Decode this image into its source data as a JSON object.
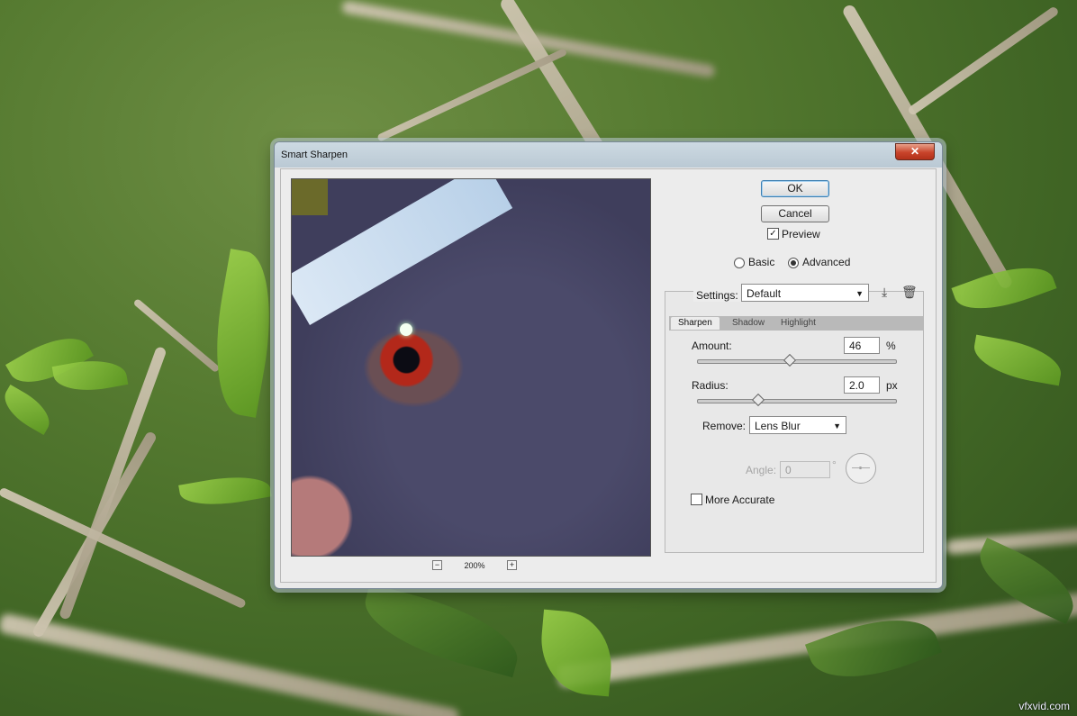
{
  "dialog": {
    "title": "Smart Sharpen",
    "close_label": "✕",
    "ok_label": "OK",
    "cancel_label": "Cancel",
    "preview_label": "Preview",
    "preview_checked": true,
    "mode_basic": "Basic",
    "mode_advanced": "Advanced",
    "mode_selected": "Advanced",
    "zoom_out_label": "−",
    "zoom_in_label": "+",
    "zoom_value": "200%",
    "settings": {
      "label": "Settings:",
      "value": "Default",
      "save_icon": "save-icon",
      "delete_icon": "trash-icon"
    },
    "tabs": [
      "Sharpen",
      "Shadow",
      "Highlight"
    ],
    "active_tab": "Sharpen",
    "sharpen": {
      "amount_label": "Amount:",
      "amount_value": "46",
      "amount_unit": "%",
      "amount_fraction": 0.46,
      "radius_label": "Radius:",
      "radius_value": "2.0",
      "radius_unit": "px",
      "radius_fraction": 0.3,
      "remove_label": "Remove:",
      "remove_value": "Lens Blur",
      "angle_label": "Angle:",
      "angle_value": "0",
      "angle_unit": "°",
      "more_accurate_label": "More Accurate",
      "more_accurate_checked": false
    }
  },
  "watermark": "vfxvid.com"
}
